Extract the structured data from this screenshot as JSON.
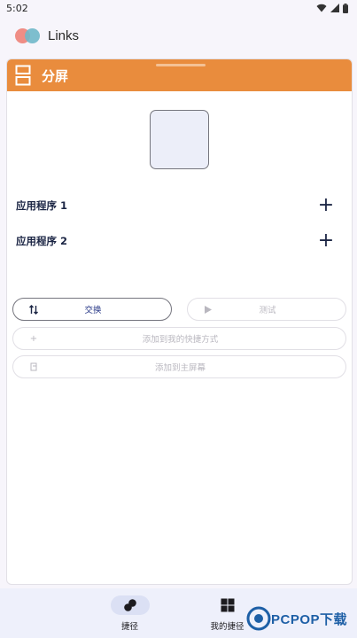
{
  "status_bar": {
    "time": "5:02"
  },
  "app_bar": {
    "title": "Links"
  },
  "card": {
    "title": "分屏",
    "header_color": "#e98c3d",
    "app_rows": [
      {
        "label": "应用程序 1",
        "action_icon": "plus-icon"
      },
      {
        "label": "应用程序 2",
        "action_icon": "plus-icon"
      }
    ],
    "buttons": {
      "swap": {
        "label": "交换",
        "icon": "swap-icon",
        "enabled": true
      },
      "test": {
        "label": "测试",
        "icon": "play-icon",
        "enabled": false
      },
      "add_shortcut": {
        "label": "添加到我的快捷方式",
        "icon": "plus-icon",
        "enabled": false
      },
      "add_home": {
        "label": "添加到主屏幕",
        "icon": "home-shortcut-icon",
        "enabled": false
      }
    }
  },
  "bottom_nav": {
    "items": [
      {
        "label": "捷径",
        "icon": "shortcut-icon",
        "active": true
      },
      {
        "label": "我的捷径",
        "icon": "grid-icon",
        "active": false
      }
    ]
  },
  "watermark": {
    "text": "PCPOP下载"
  }
}
